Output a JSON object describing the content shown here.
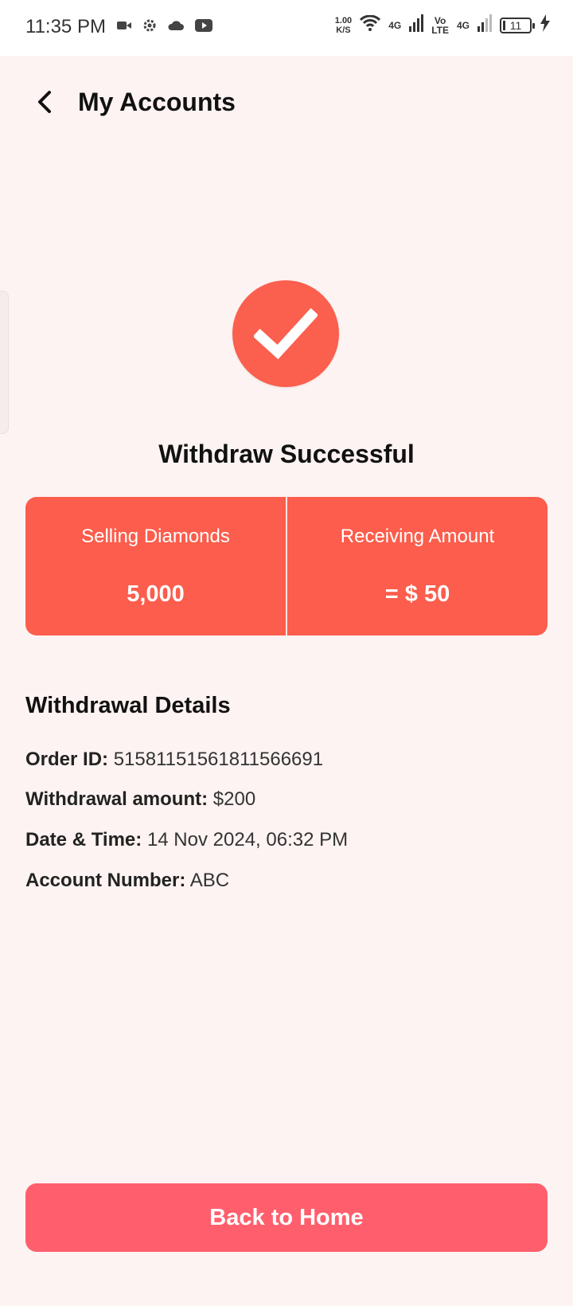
{
  "status_bar": {
    "time": "11:35 PM",
    "speed_value": "1.00",
    "speed_unit": "K/S",
    "network_1": "4G",
    "volte_top": "Vo",
    "volte_bottom": "LTE",
    "network_2": "4G",
    "battery": "11",
    "left_icons": [
      "video-camera-icon",
      "settings-gear-icon",
      "cloud-icon",
      "youtube-icon"
    ]
  },
  "header": {
    "title": "My Accounts"
  },
  "success": {
    "title": "Withdraw Successful"
  },
  "summary": {
    "left_label": "Selling Diamonds",
    "left_value": "5,000",
    "right_label": "Receiving Amount",
    "right_value": "= $ 50"
  },
  "details": {
    "title": "Withdrawal Details",
    "order_id_label": "Order ID:",
    "order_id_value": "51581151561811566691",
    "amount_label": "Withdrawal amount:",
    "amount_value": "$200",
    "datetime_label": "Date & Time:",
    "datetime_value": "14 Nov 2024, 06:32 PM",
    "account_label": "Account Number:",
    "account_value": "ABC"
  },
  "footer": {
    "home_button_label": "Back to Home"
  },
  "colors": {
    "accent": "#fc5d4c",
    "button": "#ff5f6d",
    "background": "#fdf3f2"
  }
}
